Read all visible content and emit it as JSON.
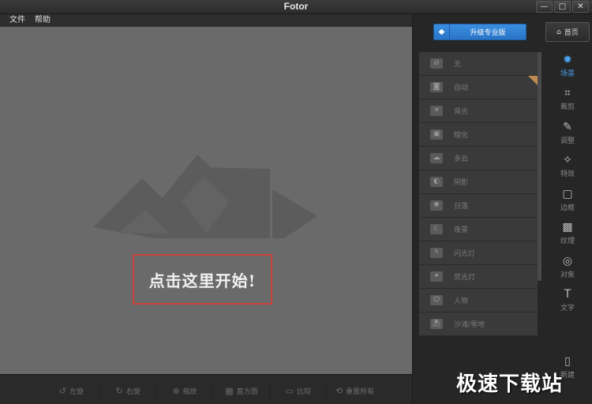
{
  "window": {
    "title": "Fotor",
    "minimize": "—",
    "maximize": "□",
    "close": "✕"
  },
  "menu": {
    "items": [
      "文件",
      "帮助"
    ]
  },
  "canvas": {
    "start_label": "点击这里开始!"
  },
  "bottom_tools": [
    {
      "label": "左旋",
      "icon": "rotate-left-icon",
      "glyph": "↺"
    },
    {
      "label": "右旋",
      "icon": "rotate-right-icon",
      "glyph": "↻"
    },
    {
      "label": "缩放",
      "icon": "zoom-icon",
      "glyph": "⊕"
    },
    {
      "label": "直方图",
      "icon": "histogram-icon",
      "glyph": "▦"
    },
    {
      "label": "比较",
      "icon": "compare-icon",
      "glyph": "▭"
    },
    {
      "label": "重置所有",
      "icon": "reset-icon",
      "glyph": "⟲"
    }
  ],
  "right_panel": {
    "upgrade_label": "升级专业版",
    "home_label": "首页",
    "scenes": [
      {
        "label": "无",
        "icon": "none-icon",
        "glyph": "⊘"
      },
      {
        "label": "自动",
        "icon": "camera-icon",
        "glyph": "◙"
      },
      {
        "label": "背光",
        "icon": "backlight-icon",
        "glyph": "☀"
      },
      {
        "label": "暗化",
        "icon": "darken-icon",
        "glyph": "▣"
      },
      {
        "label": "多云",
        "icon": "cloudy-icon",
        "glyph": "☁"
      },
      {
        "label": "阴影",
        "icon": "shade-icon",
        "glyph": "◐"
      },
      {
        "label": "日落",
        "icon": "sunset-icon",
        "glyph": "✺"
      },
      {
        "label": "夜景",
        "icon": "night-icon",
        "glyph": "☾"
      },
      {
        "label": "闪光灯",
        "icon": "flash-icon",
        "glyph": "ϟ"
      },
      {
        "label": "荧光灯",
        "icon": "fluorescent-icon",
        "glyph": "✦"
      },
      {
        "label": "人物",
        "icon": "portrait-icon",
        "glyph": "☺"
      },
      {
        "label": "沙滩/雪地",
        "icon": "beach-icon",
        "glyph": "⛱"
      }
    ],
    "tabs": [
      {
        "label": "场景",
        "icon": "scene-icon",
        "glyph": "✹",
        "active": true
      },
      {
        "label": "裁剪",
        "icon": "crop-icon",
        "glyph": "⌗"
      },
      {
        "label": "调整",
        "icon": "adjust-icon",
        "glyph": "✎"
      },
      {
        "label": "特效",
        "icon": "effects-icon",
        "glyph": "✧"
      },
      {
        "label": "边框",
        "icon": "border-icon",
        "glyph": "▢"
      },
      {
        "label": "纹理",
        "icon": "texture-icon",
        "glyph": "▩"
      },
      {
        "label": "对焦",
        "icon": "focus-icon",
        "glyph": "◎"
      },
      {
        "label": "文字",
        "icon": "text-icon",
        "glyph": "T"
      },
      {
        "label": "",
        "icon": "spacer",
        "glyph": ""
      },
      {
        "label": "新建",
        "icon": "new-file-icon",
        "glyph": "▯"
      }
    ]
  },
  "watermark": "极速下载站",
  "colors": {
    "accent": "#4aa0ee",
    "highlight_border": "#c8413a",
    "canvas_bg": "#6a6a6a"
  }
}
